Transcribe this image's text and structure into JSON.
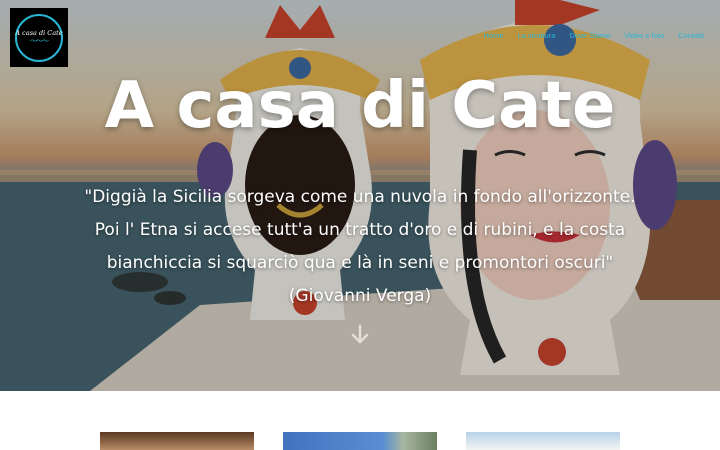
{
  "logo": {
    "text": "A casa di Cate",
    "wave": "〜〜〜"
  },
  "nav": {
    "items": [
      {
        "label": "Home"
      },
      {
        "label": "La struttura"
      },
      {
        "label": "Dove Siamo"
      },
      {
        "label": "Video e foto"
      },
      {
        "label": "Contatti"
      }
    ]
  },
  "hero": {
    "title": "A casa di Cate",
    "quote_lines": [
      "\"Diggià la Sicilia sorgeva come una nuvola in fondo all'orizzonte.",
      "Poi l' Etna si accese tutt'a un tratto d'oro e di rubini, e la costa",
      "bianchiccia si squarciò qua e là in seni e promontori oscuri\"",
      "(Giovanni Verga)"
    ],
    "scroll_icon": "arrow-down-icon"
  },
  "gallery": {
    "icon": "photo-thumbnail"
  },
  "colors": {
    "accent": "#29b6d3",
    "logo_bg": "#000000",
    "text": "#ffffff"
  }
}
